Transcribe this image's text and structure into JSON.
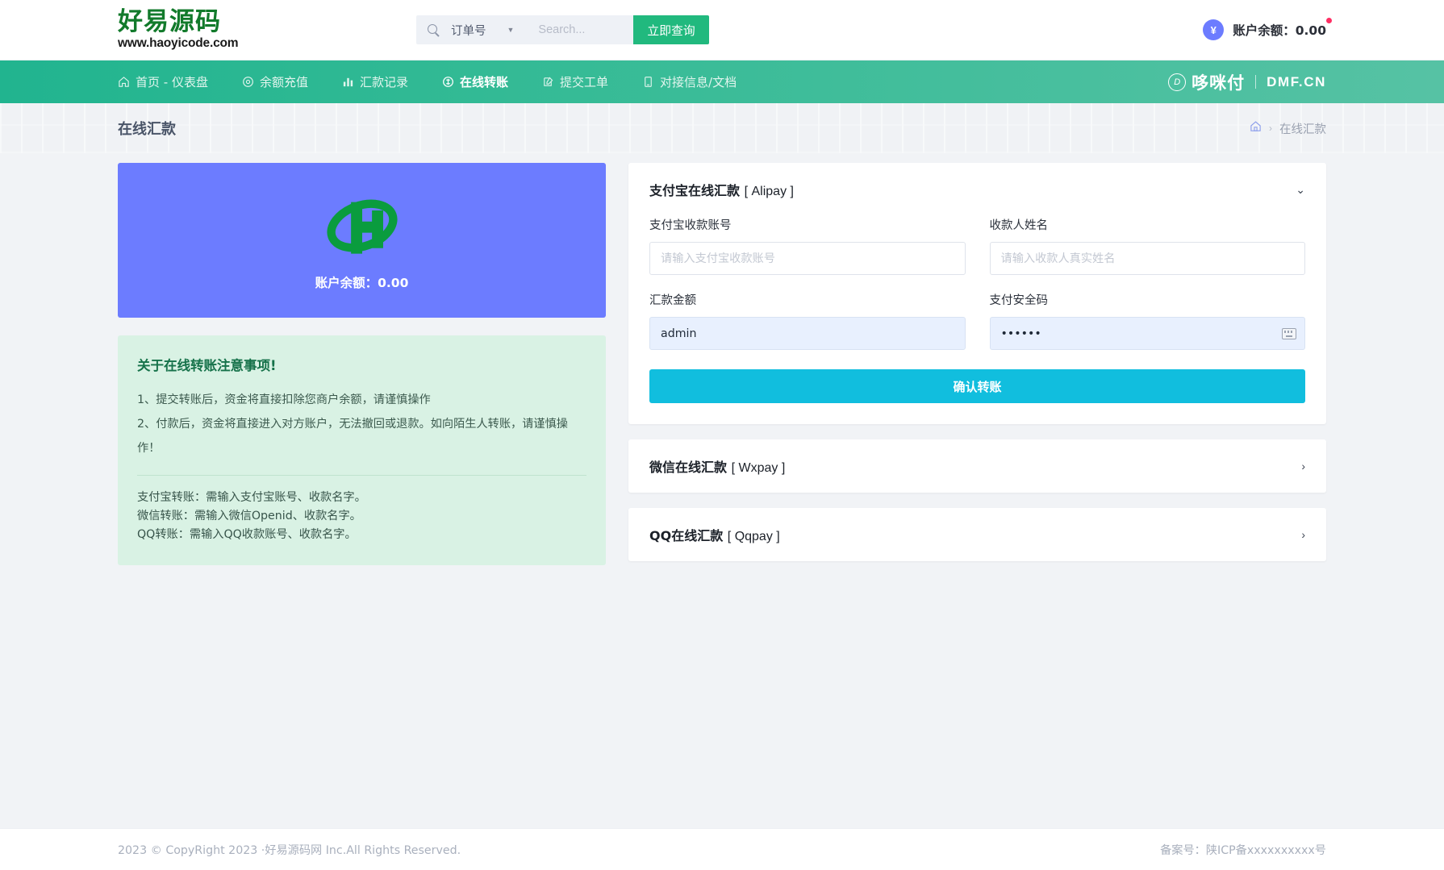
{
  "topbar": {
    "logo_cn": "好易源码",
    "logo_url": "www.haoyicode.com",
    "search": {
      "icon": "search-icon",
      "select_label": "订单号",
      "caret": "▼",
      "placeholder": "Search...",
      "value": "",
      "button_label": "立即查询"
    },
    "account": {
      "coin_symbol": "¥",
      "balance_label": "账户余额：0.00"
    }
  },
  "nav": {
    "items": [
      {
        "icon": "home-icon",
        "label": "首页 - 仪表盘",
        "active": false
      },
      {
        "icon": "wallet-icon",
        "label": "余额充值",
        "active": false
      },
      {
        "icon": "chart-bar-icon",
        "label": "汇款记录",
        "active": false
      },
      {
        "icon": "transfer-icon",
        "label": "在线转账",
        "active": true
      },
      {
        "icon": "ticket-icon",
        "label": "提交工单",
        "active": false
      },
      {
        "icon": "book-icon",
        "label": "对接信息/文档",
        "active": false
      }
    ],
    "brand": {
      "cn": "哆咪付",
      "en": "DMF.CN",
      "mark": "D"
    }
  },
  "pagehead": {
    "title": "在线汇款",
    "breadcrumb": {
      "home_icon": "home-icon",
      "separator": "›",
      "current": "在线汇款"
    }
  },
  "balance_card": {
    "logo_alt": "haoyicode-h-logo",
    "text": "账户余额：0.00"
  },
  "notice": {
    "title": "关于在线转账注意事项!",
    "lines": [
      "1、提交转账后，资金将直接扣除您商户余额，请谨慎操作",
      "2、付款后，资金将直接进入对方账户，无法撤回或退款。如向陌生人转账，请谨慎操作！"
    ],
    "sub_lines": [
      "支付宝转账：需输入支付宝账号、收款名字。",
      "微信转账：需输入微信Openid、收款名字。",
      "QQ转账：需输入QQ收款账号、收款名字。"
    ]
  },
  "panels": {
    "alipay": {
      "title_cn": "支付宝在线汇款",
      "title_en": "[ Alipay ]",
      "chevron": "⌄",
      "expanded": true,
      "fields": {
        "account": {
          "label": "支付宝收款账号",
          "placeholder": "请输入支付宝收款账号",
          "value": ""
        },
        "name": {
          "label": "收款人姓名",
          "placeholder": "请输入收款人真实姓名",
          "value": ""
        },
        "amount": {
          "label": "汇款金额",
          "placeholder": "",
          "value": "admin"
        },
        "paycode": {
          "label": "支付安全码",
          "placeholder": "",
          "value": "••••••",
          "icon": "keyboard-icon"
        }
      },
      "submit_label": "确认转账"
    },
    "wxpay": {
      "title_cn": "微信在线汇款",
      "title_en": "[ Wxpay ]",
      "chevron": "›",
      "expanded": false
    },
    "qqpay": {
      "title_cn": "QQ在线汇款",
      "title_en": "[ Qqpay ]",
      "chevron": "›",
      "expanded": false
    }
  },
  "footer": {
    "left": "2023 © CopyRight 2023 ·好易源码网 Inc.All Rights Reserved.",
    "right": "备案号：陕ICP备xxxxxxxxxx号"
  },
  "colors": {
    "nav_green": "#36bb96",
    "search_green": "#21b97e",
    "balance_blue": "#6c7cff",
    "submit_cyan": "#11bede",
    "notice_bg": "#d9f2e4",
    "logo_green": "#127a2b"
  }
}
